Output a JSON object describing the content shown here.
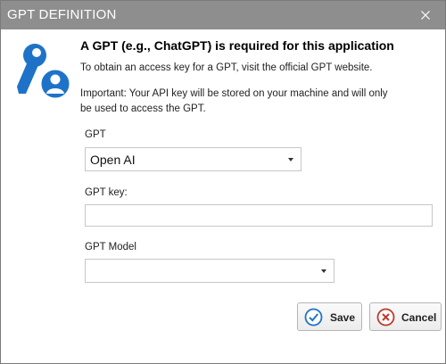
{
  "window": {
    "title": "GPT DEFINITION"
  },
  "header": {
    "heading": "A GPT (e.g., ChatGPT) is required for this application",
    "info_access": "To obtain an access key for a GPT, visit the official GPT website.",
    "info_important": "Important: Your API key will be stored on your machine and will only be used to access the GPT."
  },
  "form": {
    "gpt_label": "GPT",
    "gpt_selected": "Open AI",
    "key_label": "GPT key:",
    "key_value": "",
    "model_label": "GPT Model",
    "model_selected": ""
  },
  "buttons": {
    "save_label": "Save",
    "cancel_label": "Cancel"
  },
  "icons": {
    "close": "close-icon",
    "key": "key-user-icon",
    "save": "check-circle-icon",
    "cancel": "x-circle-icon"
  },
  "colors": {
    "titlebar": "#8e8e8e",
    "icon_blue": "#1e73c8",
    "cancel_red": "#c0392b"
  }
}
